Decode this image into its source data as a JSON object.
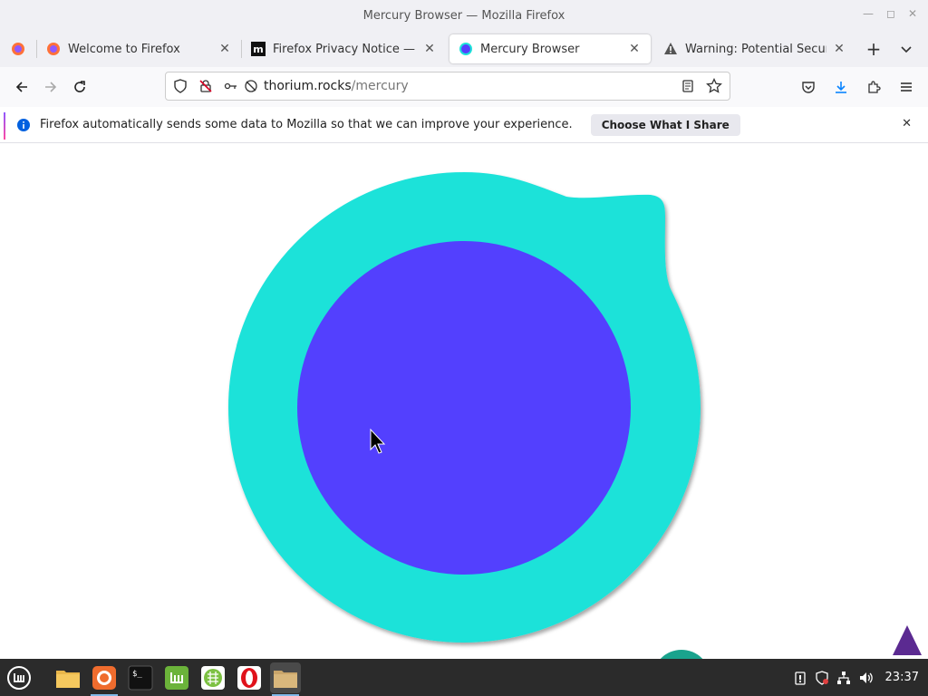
{
  "window": {
    "title": "Mercury Browser — Mozilla Firefox"
  },
  "tabs": [
    {
      "label": "Welcome to Firefox",
      "icon": "firefox-icon",
      "active": false
    },
    {
      "label": "Firefox Privacy Notice — M",
      "icon": "mozilla-m-icon",
      "active": false
    },
    {
      "label": "Mercury Browser",
      "icon": "mercury-icon",
      "active": true
    },
    {
      "label": "Warning: Potential Security",
      "icon": "warning-icon",
      "active": false
    }
  ],
  "navbar": {
    "url_host": "thorium.rocks",
    "url_path": "/mercury"
  },
  "notification": {
    "text": "Firefox automatically sends some data to Mozilla so that we can improve your experience.",
    "button_label": "Choose What I Share"
  },
  "page": {
    "logo_outer_color": "#1de2d9",
    "logo_inner_color": "#5340fe",
    "triangle_color": "#5b2a91",
    "partial_circle_color": "#1aa38d"
  },
  "taskbar": {
    "apps": [
      "files-icon",
      "firefox-icon",
      "terminal-icon",
      "mintupdate-icon",
      "spreadsheet-icon",
      "opera-icon",
      "archive-icon"
    ],
    "clock": "23:37"
  }
}
